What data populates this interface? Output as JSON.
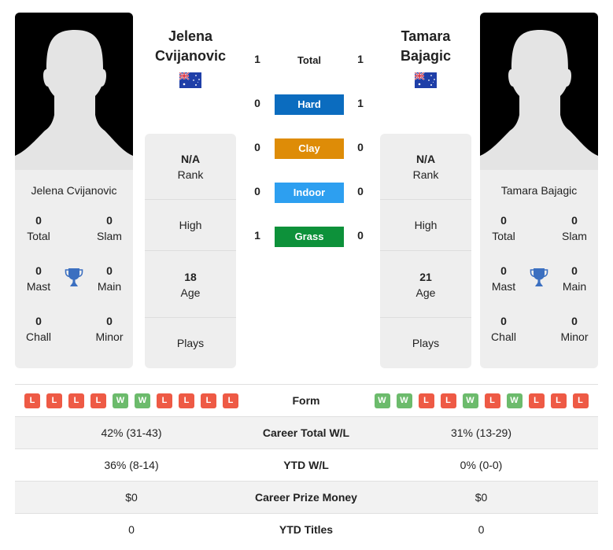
{
  "players": {
    "left": {
      "name_line1": "Jelena",
      "name_line2": "Cvijanovic",
      "full_name": "Jelena Cvijanovic",
      "country_flag": "australia-flag",
      "titles": {
        "total": {
          "value": "0",
          "label": "Total"
        },
        "slam": {
          "value": "0",
          "label": "Slam"
        },
        "mast": {
          "value": "0",
          "label": "Mast"
        },
        "main": {
          "value": "0",
          "label": "Main"
        },
        "chall": {
          "value": "0",
          "label": "Chall"
        },
        "minor": {
          "value": "0",
          "label": "Minor"
        }
      },
      "info": {
        "rank": {
          "value": "N/A",
          "label": "Rank"
        },
        "high": {
          "value": "",
          "label": "High"
        },
        "age": {
          "value": "18",
          "label": "Age"
        },
        "plays": {
          "value": "",
          "label": "Plays"
        }
      }
    },
    "right": {
      "name_line1": "Tamara",
      "name_line2": "Bajagic",
      "full_name": "Tamara Bajagic",
      "country_flag": "australia-flag",
      "titles": {
        "total": {
          "value": "0",
          "label": "Total"
        },
        "slam": {
          "value": "0",
          "label": "Slam"
        },
        "mast": {
          "value": "0",
          "label": "Mast"
        },
        "main": {
          "value": "0",
          "label": "Main"
        },
        "chall": {
          "value": "0",
          "label": "Chall"
        },
        "minor": {
          "value": "0",
          "label": "Minor"
        }
      },
      "info": {
        "rank": {
          "value": "N/A",
          "label": "Rank"
        },
        "high": {
          "value": "",
          "label": "High"
        },
        "age": {
          "value": "21",
          "label": "Age"
        },
        "plays": {
          "value": "",
          "label": "Plays"
        }
      }
    }
  },
  "h2h": [
    {
      "surface": "Total",
      "left": "1",
      "right": "1",
      "color": ""
    },
    {
      "surface": "Hard",
      "left": "0",
      "right": "1",
      "color": "#0b6cbf"
    },
    {
      "surface": "Clay",
      "left": "0",
      "right": "0",
      "color": "#de8c07"
    },
    {
      "surface": "Indoor",
      "left": "0",
      "right": "0",
      "color": "#2d9ff0"
    },
    {
      "surface": "Grass",
      "left": "1",
      "right": "0",
      "color": "#0d913a"
    }
  ],
  "form": {
    "label": "Form",
    "left": [
      "L",
      "L",
      "L",
      "L",
      "W",
      "W",
      "L",
      "L",
      "L",
      "L"
    ],
    "right": [
      "W",
      "W",
      "L",
      "L",
      "W",
      "L",
      "W",
      "L",
      "L",
      "L"
    ]
  },
  "stats": [
    {
      "label": "Career Total W/L",
      "left": "42% (31-43)",
      "right": "31% (13-29)"
    },
    {
      "label": "YTD W/L",
      "left": "36% (8-14)",
      "right": "0% (0-0)"
    },
    {
      "label": "Career Prize Money",
      "left": "$0",
      "right": "$0"
    },
    {
      "label": "YTD Titles",
      "left": "0",
      "right": "0"
    }
  ],
  "colors": {
    "loss": "#ee5a45",
    "win": "#6cbb6c",
    "trophy": "#3b6fc0"
  }
}
